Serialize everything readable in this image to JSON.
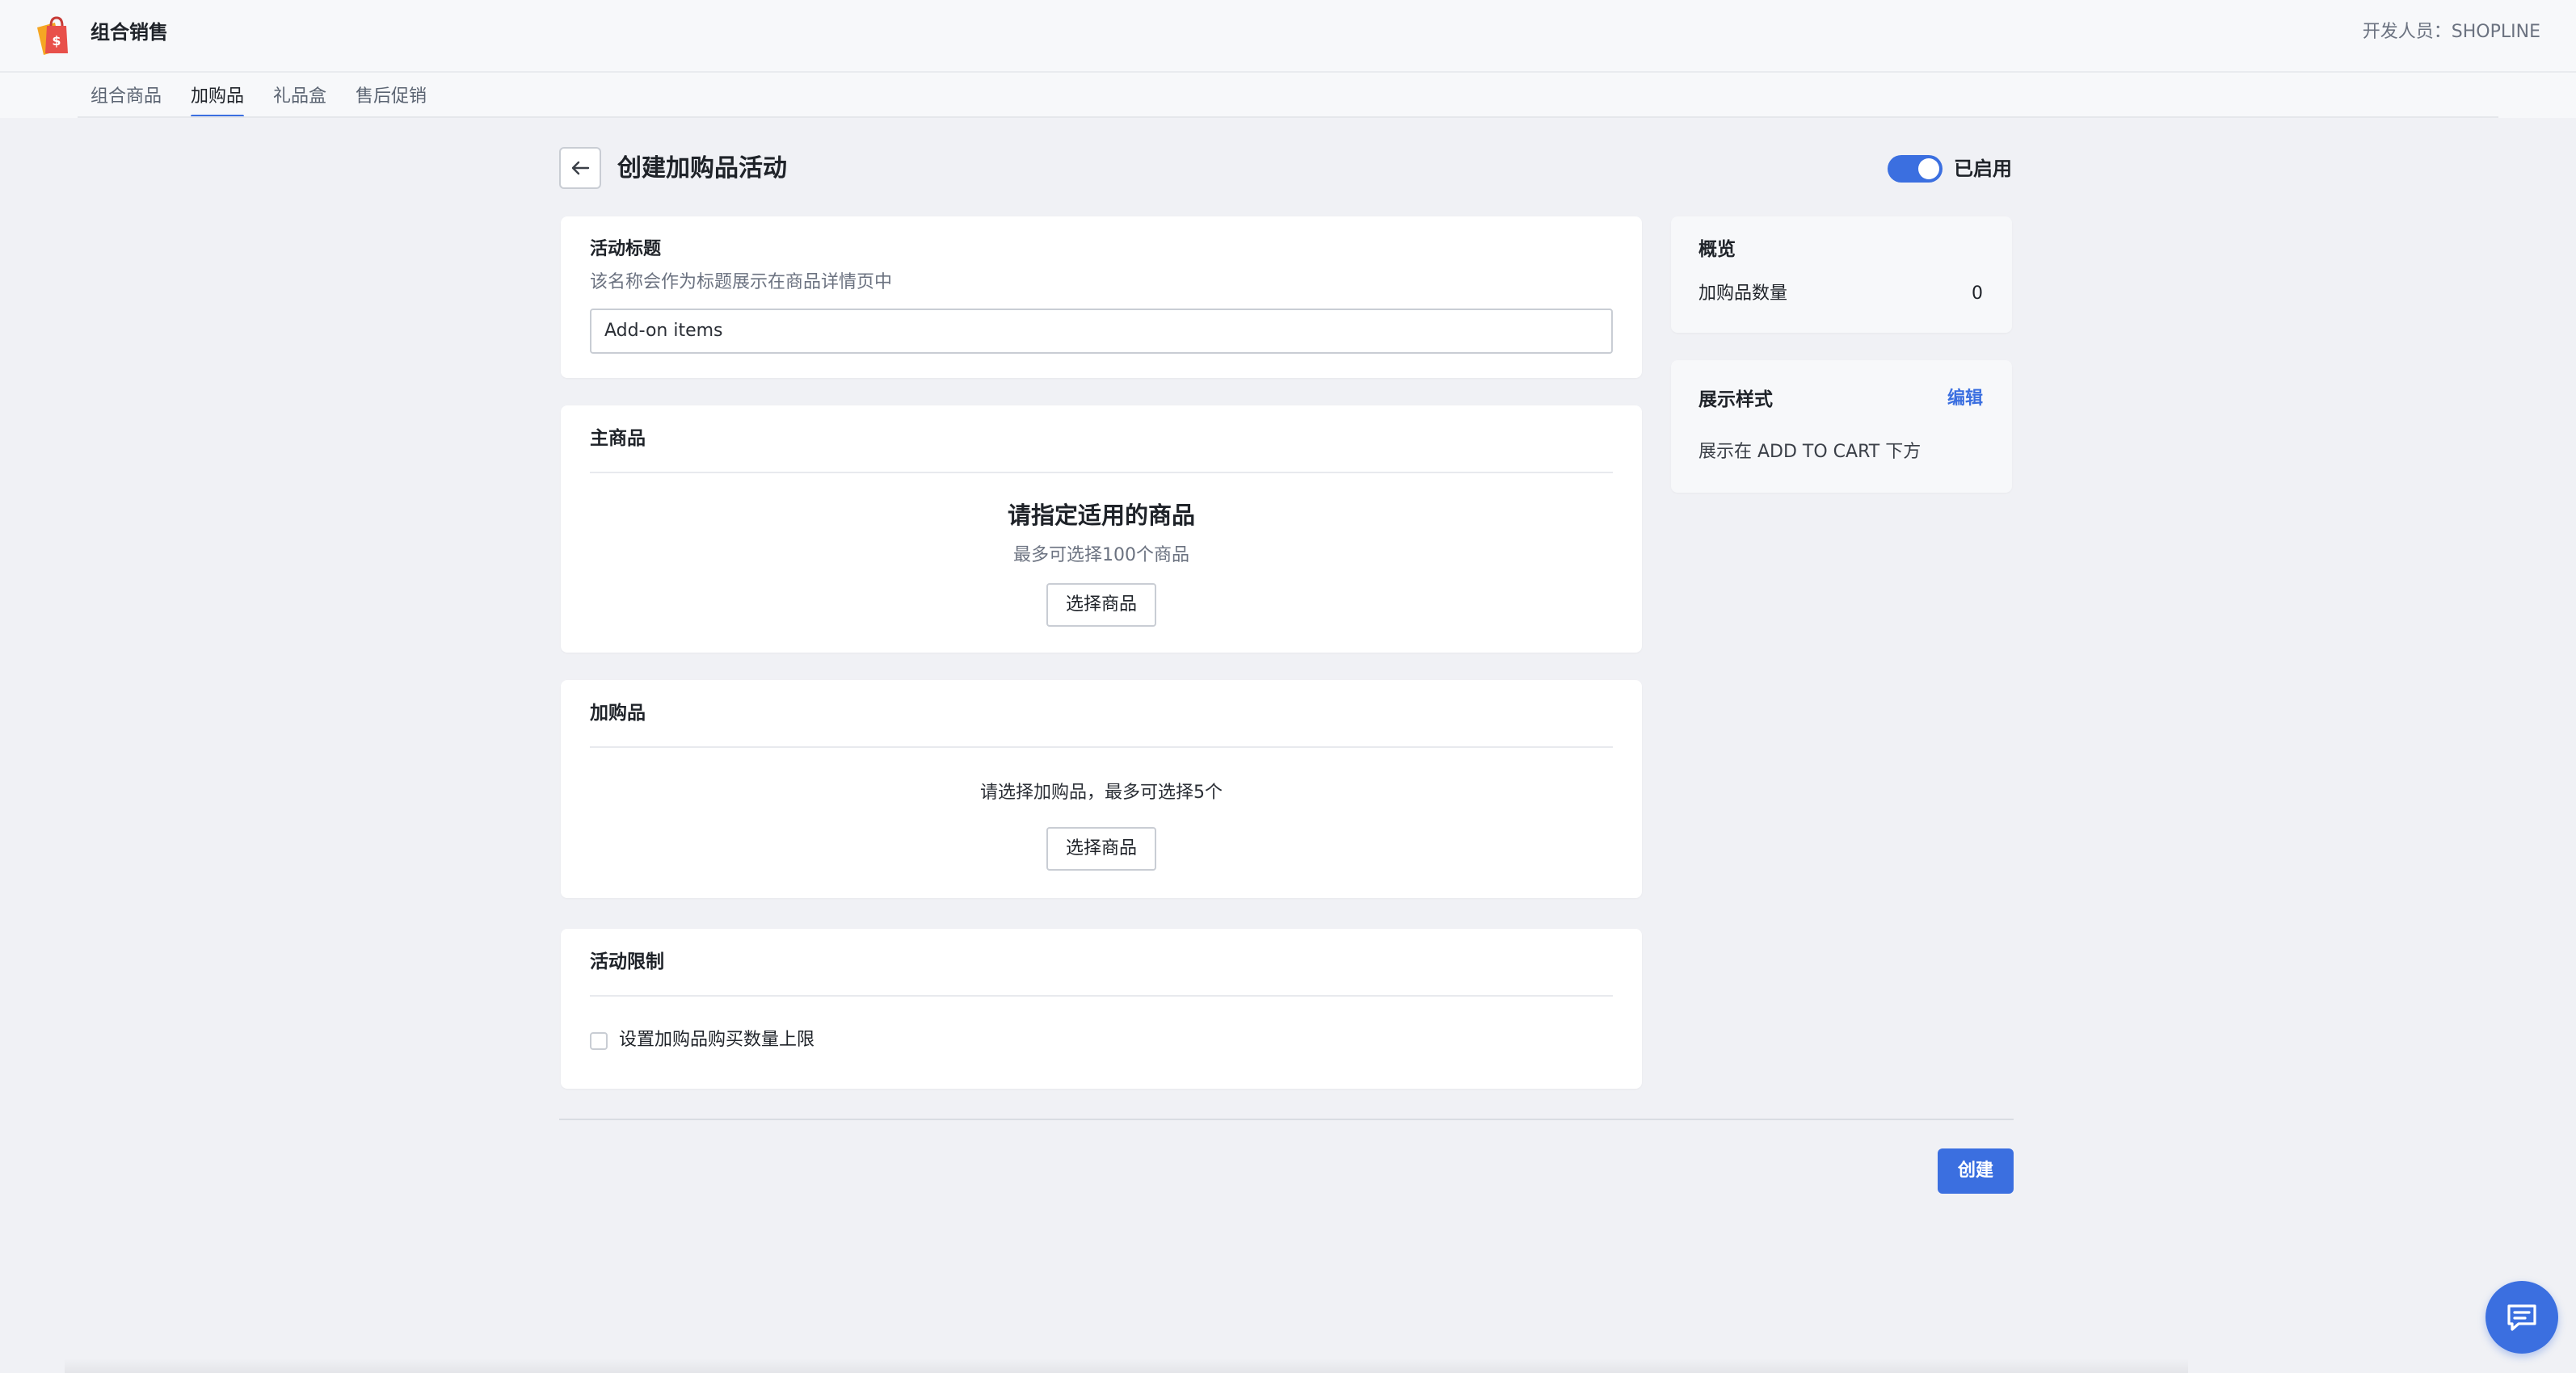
{
  "app": {
    "title": "组合销售",
    "developer": "开发人员：SHOPLINE"
  },
  "tabs": [
    {
      "label": "组合商品"
    },
    {
      "label": "加购品",
      "active": true
    },
    {
      "label": "礼品盒"
    },
    {
      "label": "售后促销"
    }
  ],
  "page": {
    "title": "创建加购品活动",
    "status_label": "已启用",
    "status_enabled": true
  },
  "activity_title": {
    "heading": "活动标题",
    "helper": "该名称会作为标题展示在商品详情页中",
    "value": "Add-on items"
  },
  "main_product": {
    "heading": "主商品",
    "empty_title": "请指定适用的商品",
    "empty_sub": "最多可选择100个商品",
    "button": "选择商品"
  },
  "addon": {
    "heading": "加购品",
    "empty_text": "请选择加购品，最多可选择5个",
    "button": "选择商品"
  },
  "limits": {
    "heading": "活动限制",
    "checkbox_label": "设置加购品购买数量上限",
    "checked": false
  },
  "overview": {
    "heading": "概览",
    "count_label": "加购品数量",
    "count_value": "0"
  },
  "display_style": {
    "heading": "展示样式",
    "edit_label": "编辑",
    "text": "展示在 ADD TO CART 下方"
  },
  "footer": {
    "create_label": "创建"
  },
  "colors": {
    "accent": "#3b6fe0",
    "background": "#f0f1f5",
    "logo_orange": "#f5a623",
    "logo_red": "#e8504a"
  },
  "icons": {
    "logo": "shopping-bag-icon",
    "back": "arrow-left-icon",
    "chat": "chat-icon"
  }
}
